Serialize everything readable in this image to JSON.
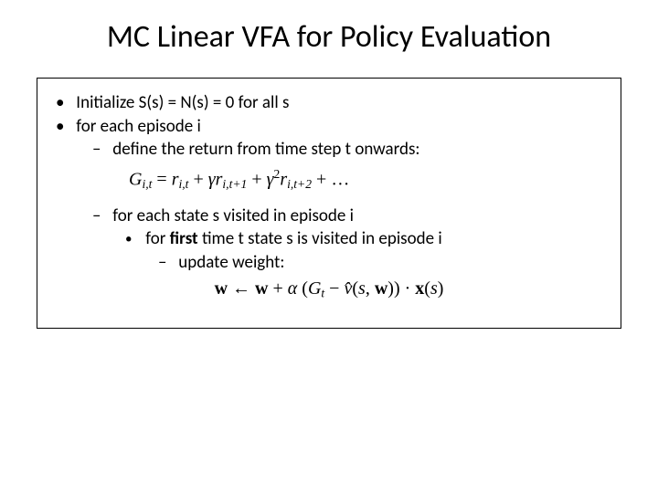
{
  "title": "MC Linear VFA for Policy Evaluation",
  "bullets": {
    "init": "Initialize S(s) = N(s) = 0 for all s",
    "forEpisode": "for each episode i",
    "defineReturn": "define the return from time step t onwards:",
    "forState": "for each state s visited in episode i",
    "firstTime_prefix": "for ",
    "firstTime_bold": "first",
    "firstTime_suffix": " time t state s is visited in episode i",
    "updateWeight": "update weight:"
  },
  "formulas": {
    "returnEq": {
      "G": "G",
      "sub_it": "i,t",
      "eq": " = ",
      "r": "r",
      "plus": " + ",
      "gamma": "γ",
      "sub_it1": "i,t+1",
      "sup2": "2",
      "sub_it2": "i,t+2",
      "dots": " + …"
    },
    "weightEq": {
      "w": "w",
      "arrow": " ← ",
      "plus": " + ",
      "alpha": "α",
      "lpar": " (",
      "G": "G",
      "sub_t": "t",
      "minus": " − ",
      "vhat": "v̂",
      "lp2": "(",
      "s": "s",
      "comma": ", ",
      "rp2": ")",
      "rpar": ") · ",
      "x": "x",
      "lp3": "(",
      "rp3": ")"
    }
  }
}
